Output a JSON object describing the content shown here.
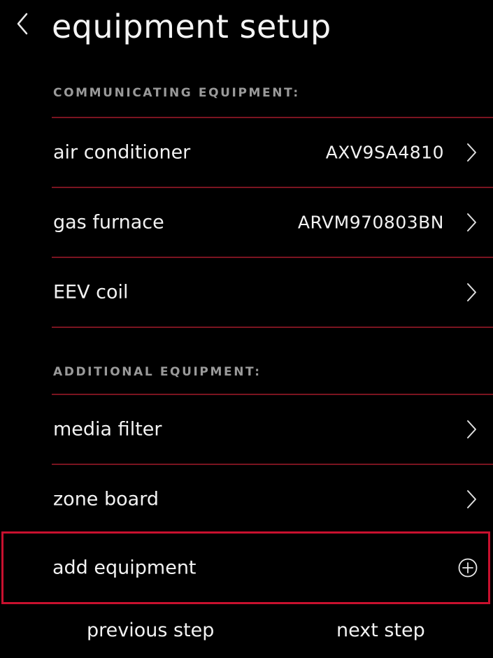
{
  "header": {
    "back_icon": "chevron-left-icon",
    "title": "equipment setup"
  },
  "sections": {
    "communicating": {
      "header": "COMMUNICATING EQUIPMENT:",
      "items": [
        {
          "label": "air conditioner",
          "value": "AXV9SA4810",
          "icon": "chevron-right-icon"
        },
        {
          "label": "gas furnace",
          "value": "ARVM970803BN",
          "icon": "chevron-right-icon"
        },
        {
          "label": "EEV coil",
          "value": "",
          "icon": "chevron-right-icon"
        }
      ]
    },
    "additional": {
      "header": "ADDITIONAL EQUIPMENT:",
      "items": [
        {
          "label": "media filter",
          "icon": "chevron-right-icon"
        },
        {
          "label": "zone board",
          "icon": "chevron-right-icon"
        }
      ]
    }
  },
  "add_equipment": {
    "label": "add equipment",
    "icon": "plus-circle-icon"
  },
  "footer": {
    "previous_label": "previous step",
    "next_label": "next step"
  },
  "colors": {
    "background": "#000000",
    "divider": "#7a1420",
    "highlight_border": "#c8102e",
    "section_header_text": "#9a9a9a",
    "text": "#f2f2f2"
  }
}
